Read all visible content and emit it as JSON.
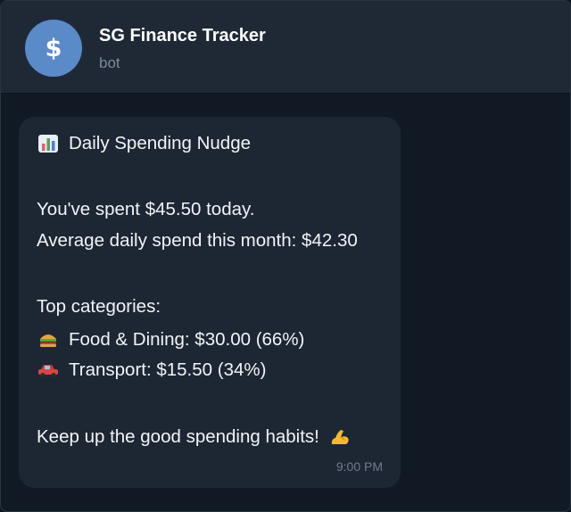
{
  "chat": {
    "title": "SG Finance Tracker",
    "subtitle": "bot",
    "avatar_symbol": "$",
    "avatar_color": "#5b8ac9"
  },
  "message": {
    "heading": "Daily Spending Nudge",
    "spent_line": "You've spent $45.50 today.",
    "average_line": "Average daily spend this month: $42.30",
    "categories_label": "Top categories:",
    "category_food": "Food & Dining: $30.00 (66%)",
    "category_transport": "Transport: $15.50 (34%)",
    "closing_line": "Keep up the good spending habits!",
    "time": "9:00 PM",
    "icons": {
      "heading": "bar-chart-icon",
      "food": "burger-icon",
      "transport": "car-icon",
      "closing": "flexed-biceps-icon"
    }
  }
}
